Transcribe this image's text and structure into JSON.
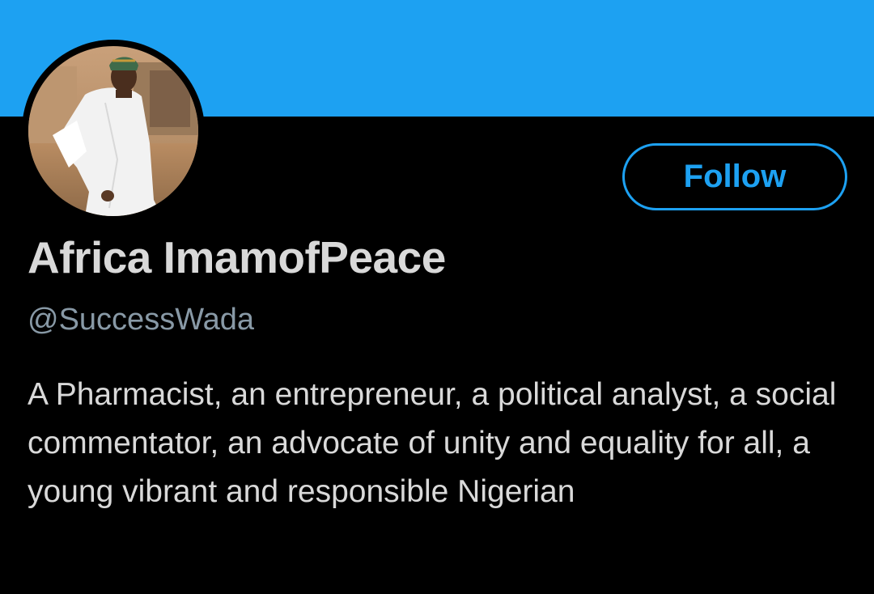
{
  "profile": {
    "display_name": "Africa ImamofPeace",
    "handle": "@SuccessWada",
    "bio": "A Pharmacist, an entrepreneur, a political analyst, a social commentator, an advocate of unity and equality for all, a young vibrant and responsible Nigerian",
    "follow_label": "Follow"
  },
  "colors": {
    "accent": "#1da1f2",
    "background": "#000000",
    "primary_text": "#d9d9d9",
    "secondary_text": "#8899a6"
  }
}
